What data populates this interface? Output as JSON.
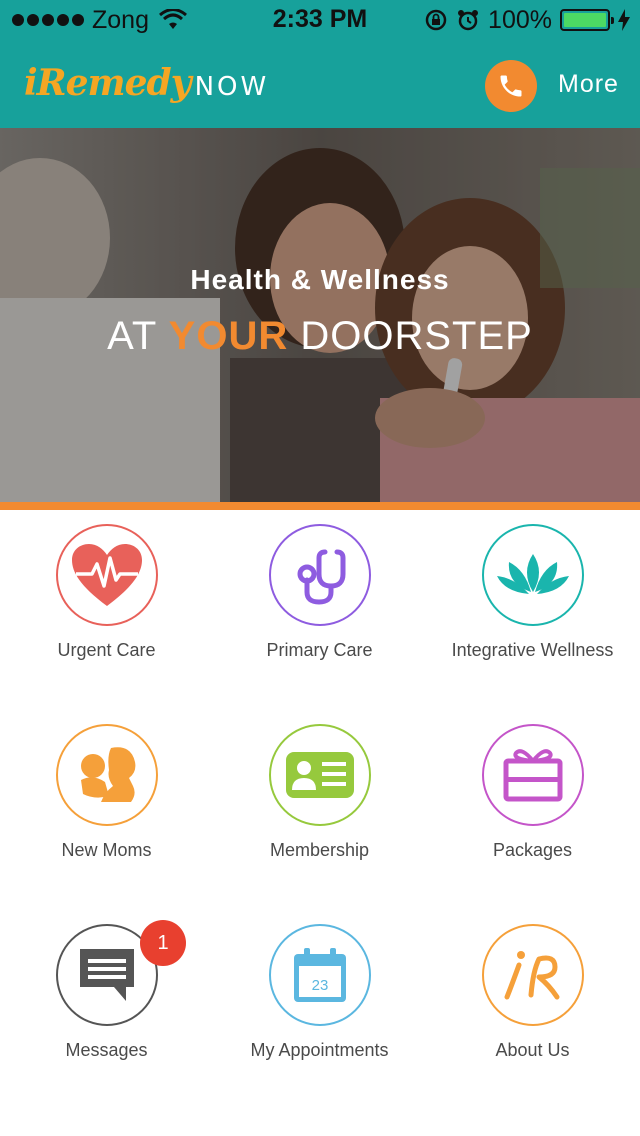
{
  "status_bar": {
    "carrier": "Zong",
    "time": "2:33 PM",
    "battery": "100%"
  },
  "header": {
    "logo_script": "iRemedy",
    "logo_now": "NOW",
    "more_label": "More",
    "brand_color": "#17a19b",
    "accent_color": "#f28a30"
  },
  "hero": {
    "subtitle": "Health & Wellness",
    "title_pre": "AT",
    "title_accent": "YOUR",
    "title_post": "DOORSTEP"
  },
  "tiles": [
    {
      "label": "Urgent Care",
      "icon": "heart-pulse-icon",
      "color": "#e8615a"
    },
    {
      "label": "Primary Care",
      "icon": "stethoscope-icon",
      "color": "#8e5ce0"
    },
    {
      "label": "Integrative Wellness",
      "icon": "lotus-icon",
      "color": "#1ab5ad"
    },
    {
      "label": "New Moms",
      "icon": "mother-baby-icon",
      "color": "#f5a03a"
    },
    {
      "label": "Membership",
      "icon": "id-card-icon",
      "color": "#96c93d"
    },
    {
      "label": "Packages",
      "icon": "gift-box-icon",
      "color": "#c455c9"
    },
    {
      "label": "Messages",
      "icon": "chat-bubble-icon",
      "color": "#555555",
      "badge": "1"
    },
    {
      "label": "My Appointments",
      "icon": "calendar-icon",
      "color": "#5bb7e0",
      "calendar_day": "23"
    },
    {
      "label": "About Us",
      "icon": "ir-logo-icon",
      "color": "#f5a03a"
    }
  ]
}
